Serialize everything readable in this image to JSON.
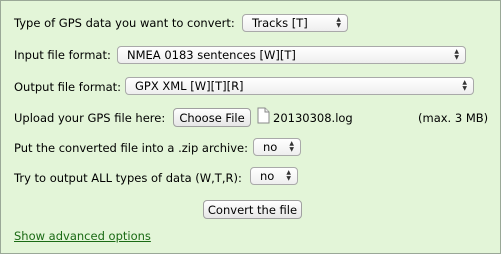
{
  "form": {
    "gps_type": {
      "label": "Type of GPS data you want to convert:",
      "value": "Tracks [T]"
    },
    "input_format": {
      "label": "Input file format:",
      "value": "NMEA 0183 sentences [W][T]"
    },
    "output_format": {
      "label": "Output file format:",
      "value": "GPX XML [W][T][R]"
    },
    "upload": {
      "label": "Upload your GPS file here:",
      "button_label": "Choose File",
      "file_name": "20130308.log",
      "max_size": "(max. 3 MB)",
      "file_icon": "document-icon"
    },
    "zip": {
      "label": "Put the converted file into a .zip archive:",
      "value": "no"
    },
    "all_types": {
      "label": "Try to output ALL types of data (W,T,R):",
      "value": "no"
    },
    "convert_button_label": "Convert the file",
    "advanced_link": "Show advanced options"
  },
  "colors": {
    "panel_background": "#e3f5d8",
    "panel_border": "#9aa897",
    "link": "#1a6a14"
  }
}
